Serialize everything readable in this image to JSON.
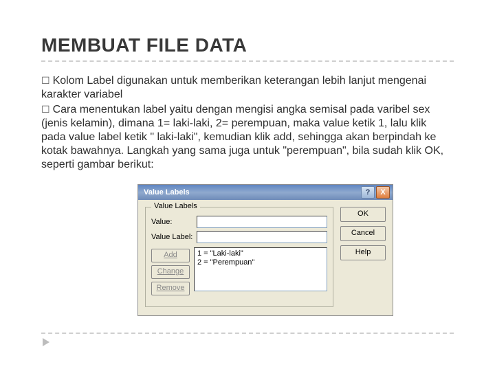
{
  "title": "MEMBUAT FILE DATA",
  "bullets": [
    "Kolom Label digunakan untuk memberikan keterangan lebih lanjut mengenai karakter variabel",
    "Cara menentukan label yaitu dengan mengisi angka semisal pada varibel sex (jenis kelamin), dimana 1= laki-laki, 2= perempuan, maka value ketik 1, lalu klik pada value label ketik \" laki-laki\", kemudian klik add, sehingga akan berpindah ke kotak bawahnya. Langkah yang sama juga untuk \"perempuan\", bila sudah klik OK, seperti gambar berikut:"
  ],
  "dialog": {
    "title": "Value Labels",
    "help_glyph": "?",
    "close_glyph": "X",
    "group_legend": "Value Labels",
    "value_lbl": "Value:",
    "valuelabel_lbl": "Value Label:",
    "buttons": {
      "add": "Add",
      "change": "Change",
      "remove": "Remove",
      "ok": "OK",
      "cancel": "Cancel",
      "help": "Help"
    },
    "list": [
      "1 = \"Laki-laki\"",
      "2 = \"Perempuan\""
    ]
  }
}
